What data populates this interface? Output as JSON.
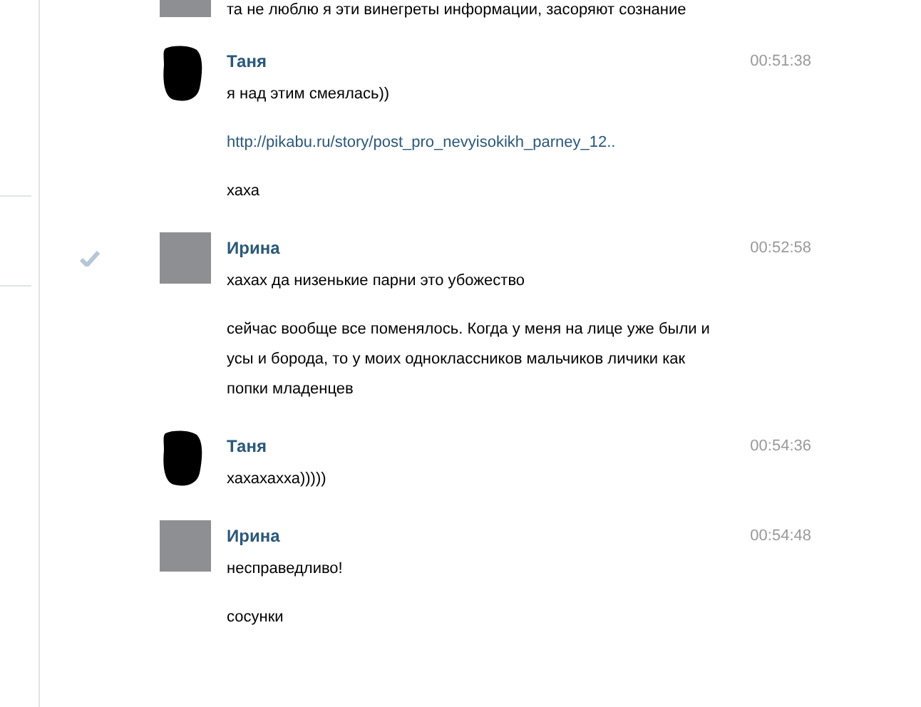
{
  "messages": [
    {
      "kind": "photo",
      "checked": false,
      "paragraphs": [
        {
          "kind": "text",
          "text": "та не люблю я эти винегреты информации, засоряют сознание"
        }
      ]
    },
    {
      "author": "Таня",
      "time": "00:51:38",
      "kind": "redacted",
      "checked": false,
      "paragraphs": [
        {
          "kind": "text",
          "text": "я над этим смеялась))"
        },
        {
          "kind": "link",
          "text": "http://pikabu.ru/story/post_pro_nevyisokikh_parney_12.."
        },
        {
          "kind": "text",
          "text": "хаха"
        }
      ]
    },
    {
      "author": "Ирина",
      "time": "00:52:58",
      "kind": "photo",
      "checked": true,
      "paragraphs": [
        {
          "kind": "text",
          "text": "хахах да низенькие парни это убожество"
        },
        {
          "kind": "text",
          "text": "сейчас вообще все поменялось. Когда у меня на лице уже были и усы и борода, то у моих одноклассников мальчиков личики как попки младенцев"
        }
      ]
    },
    {
      "author": "Таня",
      "time": "00:54:36",
      "kind": "redacted",
      "checked": false,
      "paragraphs": [
        {
          "kind": "text",
          "text": "хахахахха)))))"
        }
      ]
    },
    {
      "author": "Ирина",
      "time": "00:54:48",
      "kind": "photo",
      "checked": false,
      "paragraphs": [
        {
          "kind": "text",
          "text": "несправедливо!"
        },
        {
          "kind": "text",
          "text": "сосунки"
        }
      ]
    }
  ]
}
